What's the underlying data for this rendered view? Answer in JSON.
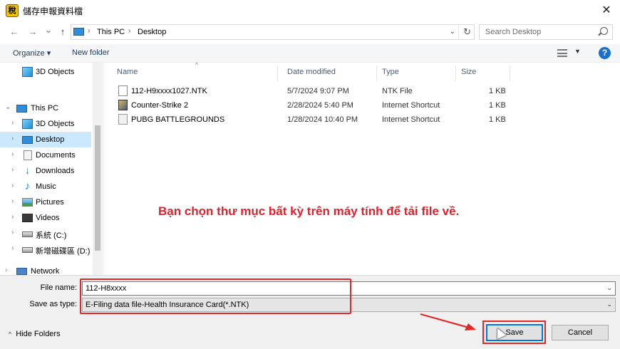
{
  "window": {
    "title": "儲存申報資料檔",
    "app_icon_glyph": "稅",
    "close_glyph": "✕"
  },
  "navigation": {
    "back_glyph": "←",
    "forward_glyph": "→",
    "recent_glyph": "⌄",
    "up_glyph": "↑",
    "breadcrumb": [
      "This PC",
      "Desktop"
    ],
    "separator_glyph": "›",
    "dropdown_glyph": "⌄",
    "refresh_glyph": "↻",
    "search_placeholder": "Search Desktop"
  },
  "toolbar": {
    "organize_label": "Organize ▾",
    "new_folder_label": "New folder",
    "view_dropdown_glyph": "▼",
    "help_glyph": "?"
  },
  "nav_pane": {
    "items": [
      {
        "label": "3D Objects",
        "icon": "3d-objects-icon",
        "chevron": ""
      },
      {
        "label": "This PC",
        "icon": "this-pc-icon",
        "chevron": "⌄"
      },
      {
        "label": "3D Objects",
        "icon": "3d-objects-icon",
        "chevron": "›"
      },
      {
        "label": "Desktop",
        "icon": "desktop-icon",
        "chevron": "›"
      },
      {
        "label": "Documents",
        "icon": "documents-icon",
        "chevron": "›"
      },
      {
        "label": "Downloads",
        "icon": "downloads-icon",
        "chevron": "›"
      },
      {
        "label": "Music",
        "icon": "music-icon",
        "chevron": "›"
      },
      {
        "label": "Pictures",
        "icon": "pictures-icon",
        "chevron": "›"
      },
      {
        "label": "Videos",
        "icon": "videos-icon",
        "chevron": "›"
      },
      {
        "label": "系統 (C:)",
        "icon": "drive-icon",
        "chevron": "›"
      },
      {
        "label": "新增磁碟區 (D:)",
        "icon": "drive-icon",
        "chevron": "›"
      },
      {
        "label": "Network",
        "icon": "network-icon",
        "chevron": "›"
      }
    ],
    "selected": "Desktop"
  },
  "file_list": {
    "columns": [
      "Name",
      "Date modified",
      "Type",
      "Size"
    ],
    "sort_indicator": "^",
    "files": [
      {
        "name": "112-H9xxxx1027.NTK",
        "date": "5/7/2024 9:07 PM",
        "type": "NTK File",
        "size": "1 KB"
      },
      {
        "name": "Counter-Strike 2",
        "date": "2/28/2024 5:40 PM",
        "type": "Internet Shortcut",
        "size": "1 KB"
      },
      {
        "name": "PUBG BATTLEGROUNDS",
        "date": "1/28/2024 10:40 PM",
        "type": "Internet Shortcut",
        "size": "1 KB"
      }
    ]
  },
  "annotation": {
    "text": "Bạn chọn thư mục bất kỳ trên máy tính để tải file về.",
    "color": "#e0202a"
  },
  "form": {
    "file_name_label": "File name:",
    "file_name_value": "112-H8xxxx",
    "save_as_type_label": "Save as type:",
    "save_as_type_value": "E-Filing data file-Health Insurance Card(*.NTK)",
    "dropdown_glyph": "⌄"
  },
  "footer": {
    "hide_folders_label": "Hide Folders",
    "hide_chevron": "^",
    "save_label": "Save",
    "cancel_label": "Cancel"
  },
  "colors": {
    "highlight_red": "#e02828",
    "selection_blue": "#cce8ff",
    "accent_blue": "#0078d7"
  }
}
